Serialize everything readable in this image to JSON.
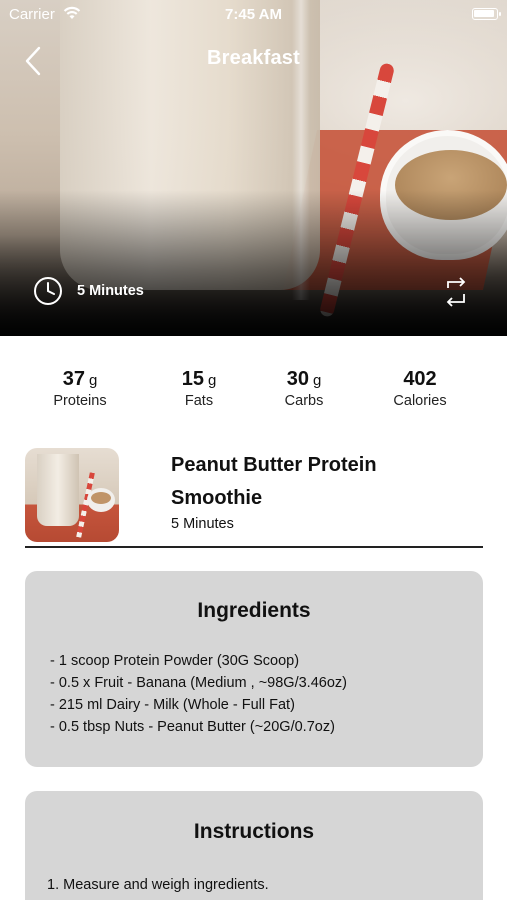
{
  "status_bar": {
    "carrier": "Carrier",
    "time": "7:45 AM",
    "wifi_icon": "wifi-icon",
    "battery_icon": "battery-icon"
  },
  "nav": {
    "title": "Breakfast",
    "back_icon": "chevron-left-icon"
  },
  "hero": {
    "duration": "5 Minutes",
    "clock_icon": "clock-icon",
    "swap_icon": "swap-icon"
  },
  "nutrition": [
    {
      "value": "37",
      "unit": "g",
      "label": "Proteins"
    },
    {
      "value": "15",
      "unit": "g",
      "label": "Fats"
    },
    {
      "value": "30",
      "unit": "g",
      "label": "Carbs"
    },
    {
      "value": "402",
      "unit": "",
      "label": "Calories"
    }
  ],
  "recipe": {
    "title_line1": "Peanut Butter Protein",
    "title_line2": "Smoothie",
    "time": "5 Minutes"
  },
  "ingredients": {
    "title": "Ingredients",
    "items": [
      "- 1 scoop Protein Powder (30G Scoop)",
      "- 0.5 x Fruit - Banana (Medium , ~98G/3.46oz)",
      "- 215 ml Dairy - Milk (Whole - Full Fat)",
      "- 0.5 tbsp Nuts - Peanut Butter (~20G/0.7oz)"
    ]
  },
  "instructions": {
    "title": "Instructions",
    "items": [
      "1.  Measure and weigh ingredients."
    ]
  },
  "colors": {
    "panel_bg": "#d6d6d6",
    "text": "#111111",
    "hero_overlay": "#000000"
  }
}
